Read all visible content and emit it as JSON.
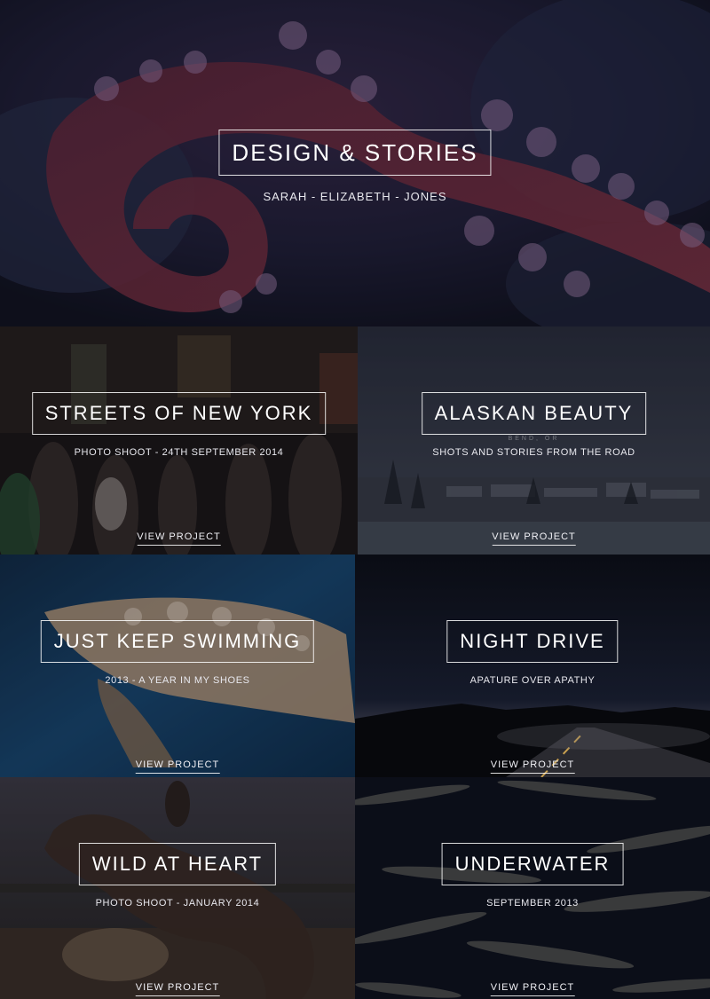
{
  "hero": {
    "title": "DESIGN & STORIES",
    "subtitle": "SARAH - ELIZABETH - JONES"
  },
  "projects": [
    {
      "title": "STREETS OF NEW YORK",
      "subtitle": "PHOTO SHOOT - 24TH SEPTEMBER 2014",
      "link": "VIEW PROJECT",
      "overlay_text": ""
    },
    {
      "title": "ALASKAN BEAUTY",
      "subtitle": "SHOTS AND STORIES FROM THE ROAD",
      "link": "VIEW PROJECT",
      "overlay_text": "BEND, OR"
    },
    {
      "title": "JUST KEEP SWIMMING",
      "subtitle": "2013 - A YEAR IN MY SHOES",
      "link": "VIEW PROJECT",
      "overlay_text": ""
    },
    {
      "title": "NIGHT DRIVE",
      "subtitle": "APATURE OVER APATHY",
      "link": "VIEW PROJECT",
      "overlay_text": ""
    },
    {
      "title": "WILD AT HEART",
      "subtitle": "PHOTO SHOOT - JANUARY 2014",
      "link": "VIEW PROJECT",
      "overlay_text": ""
    },
    {
      "title": "UNDERWATER",
      "subtitle": "SEPTEMBER 2013",
      "link": "VIEW PROJECT",
      "overlay_text": ""
    }
  ],
  "colors": {
    "text": "#ffffff",
    "background": "#0b0d14"
  }
}
